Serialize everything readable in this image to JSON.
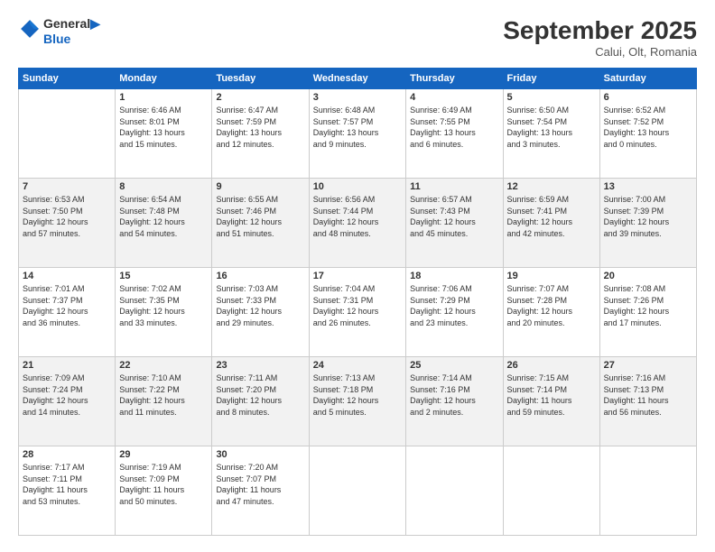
{
  "header": {
    "logo_line1": "General",
    "logo_line2": "Blue",
    "month": "September 2025",
    "location": "Calui, Olt, Romania"
  },
  "weekdays": [
    "Sunday",
    "Monday",
    "Tuesday",
    "Wednesday",
    "Thursday",
    "Friday",
    "Saturday"
  ],
  "weeks": [
    [
      {
        "day": "",
        "info": ""
      },
      {
        "day": "1",
        "info": "Sunrise: 6:46 AM\nSunset: 8:01 PM\nDaylight: 13 hours\nand 15 minutes."
      },
      {
        "day": "2",
        "info": "Sunrise: 6:47 AM\nSunset: 7:59 PM\nDaylight: 13 hours\nand 12 minutes."
      },
      {
        "day": "3",
        "info": "Sunrise: 6:48 AM\nSunset: 7:57 PM\nDaylight: 13 hours\nand 9 minutes."
      },
      {
        "day": "4",
        "info": "Sunrise: 6:49 AM\nSunset: 7:55 PM\nDaylight: 13 hours\nand 6 minutes."
      },
      {
        "day": "5",
        "info": "Sunrise: 6:50 AM\nSunset: 7:54 PM\nDaylight: 13 hours\nand 3 minutes."
      },
      {
        "day": "6",
        "info": "Sunrise: 6:52 AM\nSunset: 7:52 PM\nDaylight: 13 hours\nand 0 minutes."
      }
    ],
    [
      {
        "day": "7",
        "info": "Sunrise: 6:53 AM\nSunset: 7:50 PM\nDaylight: 12 hours\nand 57 minutes."
      },
      {
        "day": "8",
        "info": "Sunrise: 6:54 AM\nSunset: 7:48 PM\nDaylight: 12 hours\nand 54 minutes."
      },
      {
        "day": "9",
        "info": "Sunrise: 6:55 AM\nSunset: 7:46 PM\nDaylight: 12 hours\nand 51 minutes."
      },
      {
        "day": "10",
        "info": "Sunrise: 6:56 AM\nSunset: 7:44 PM\nDaylight: 12 hours\nand 48 minutes."
      },
      {
        "day": "11",
        "info": "Sunrise: 6:57 AM\nSunset: 7:43 PM\nDaylight: 12 hours\nand 45 minutes."
      },
      {
        "day": "12",
        "info": "Sunrise: 6:59 AM\nSunset: 7:41 PM\nDaylight: 12 hours\nand 42 minutes."
      },
      {
        "day": "13",
        "info": "Sunrise: 7:00 AM\nSunset: 7:39 PM\nDaylight: 12 hours\nand 39 minutes."
      }
    ],
    [
      {
        "day": "14",
        "info": "Sunrise: 7:01 AM\nSunset: 7:37 PM\nDaylight: 12 hours\nand 36 minutes."
      },
      {
        "day": "15",
        "info": "Sunrise: 7:02 AM\nSunset: 7:35 PM\nDaylight: 12 hours\nand 33 minutes."
      },
      {
        "day": "16",
        "info": "Sunrise: 7:03 AM\nSunset: 7:33 PM\nDaylight: 12 hours\nand 29 minutes."
      },
      {
        "day": "17",
        "info": "Sunrise: 7:04 AM\nSunset: 7:31 PM\nDaylight: 12 hours\nand 26 minutes."
      },
      {
        "day": "18",
        "info": "Sunrise: 7:06 AM\nSunset: 7:29 PM\nDaylight: 12 hours\nand 23 minutes."
      },
      {
        "day": "19",
        "info": "Sunrise: 7:07 AM\nSunset: 7:28 PM\nDaylight: 12 hours\nand 20 minutes."
      },
      {
        "day": "20",
        "info": "Sunrise: 7:08 AM\nSunset: 7:26 PM\nDaylight: 12 hours\nand 17 minutes."
      }
    ],
    [
      {
        "day": "21",
        "info": "Sunrise: 7:09 AM\nSunset: 7:24 PM\nDaylight: 12 hours\nand 14 minutes."
      },
      {
        "day": "22",
        "info": "Sunrise: 7:10 AM\nSunset: 7:22 PM\nDaylight: 12 hours\nand 11 minutes."
      },
      {
        "day": "23",
        "info": "Sunrise: 7:11 AM\nSunset: 7:20 PM\nDaylight: 12 hours\nand 8 minutes."
      },
      {
        "day": "24",
        "info": "Sunrise: 7:13 AM\nSunset: 7:18 PM\nDaylight: 12 hours\nand 5 minutes."
      },
      {
        "day": "25",
        "info": "Sunrise: 7:14 AM\nSunset: 7:16 PM\nDaylight: 12 hours\nand 2 minutes."
      },
      {
        "day": "26",
        "info": "Sunrise: 7:15 AM\nSunset: 7:14 PM\nDaylight: 11 hours\nand 59 minutes."
      },
      {
        "day": "27",
        "info": "Sunrise: 7:16 AM\nSunset: 7:13 PM\nDaylight: 11 hours\nand 56 minutes."
      }
    ],
    [
      {
        "day": "28",
        "info": "Sunrise: 7:17 AM\nSunset: 7:11 PM\nDaylight: 11 hours\nand 53 minutes."
      },
      {
        "day": "29",
        "info": "Sunrise: 7:19 AM\nSunset: 7:09 PM\nDaylight: 11 hours\nand 50 minutes."
      },
      {
        "day": "30",
        "info": "Sunrise: 7:20 AM\nSunset: 7:07 PM\nDaylight: 11 hours\nand 47 minutes."
      },
      {
        "day": "",
        "info": ""
      },
      {
        "day": "",
        "info": ""
      },
      {
        "day": "",
        "info": ""
      },
      {
        "day": "",
        "info": ""
      }
    ]
  ]
}
